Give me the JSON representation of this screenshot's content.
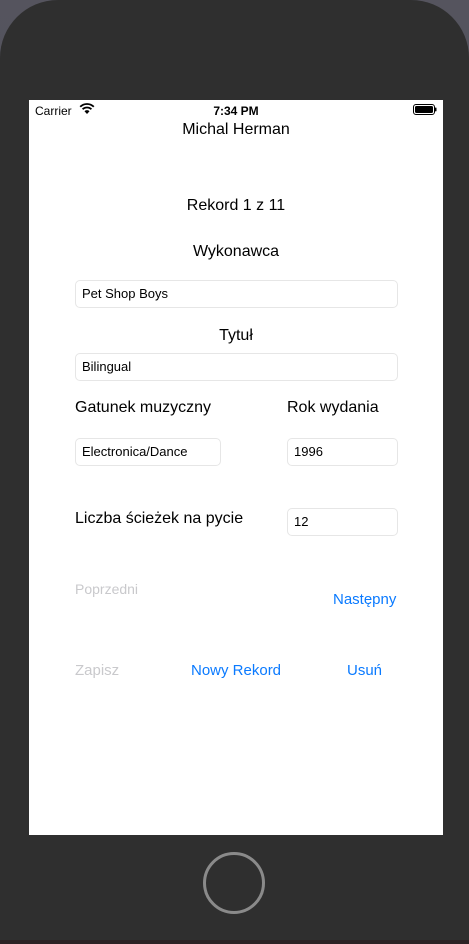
{
  "status_bar": {
    "carrier": "Carrier",
    "time": "7:34 PM",
    "wifi_icon": "wifi-icon",
    "battery_icon": "battery-icon"
  },
  "header": {
    "author": "Michal Herman"
  },
  "record": {
    "counter": "Rekord 1 z 11"
  },
  "form": {
    "artist_label": "Wykonawca",
    "artist_value": "Pet Shop Boys",
    "title_label": "Tytuł",
    "title_value": "Bilingual",
    "genre_label": "Gatunek muzyczny",
    "genre_value": "Electronica/Dance",
    "year_label": "Rok wydania",
    "year_value": "1996",
    "tracks_label": "Liczba ścieżek na pycie",
    "tracks_value": "12"
  },
  "navigation": {
    "previous_label": "Poprzedni",
    "next_label": "Następny"
  },
  "actions": {
    "save_label": "Zapisz",
    "new_record_label": "Nowy Rekord",
    "delete_label": "Usuń"
  },
  "colors": {
    "accent": "#0a7aff",
    "disabled": "#c9c9cc",
    "device_frame": "#2f2f2f"
  }
}
